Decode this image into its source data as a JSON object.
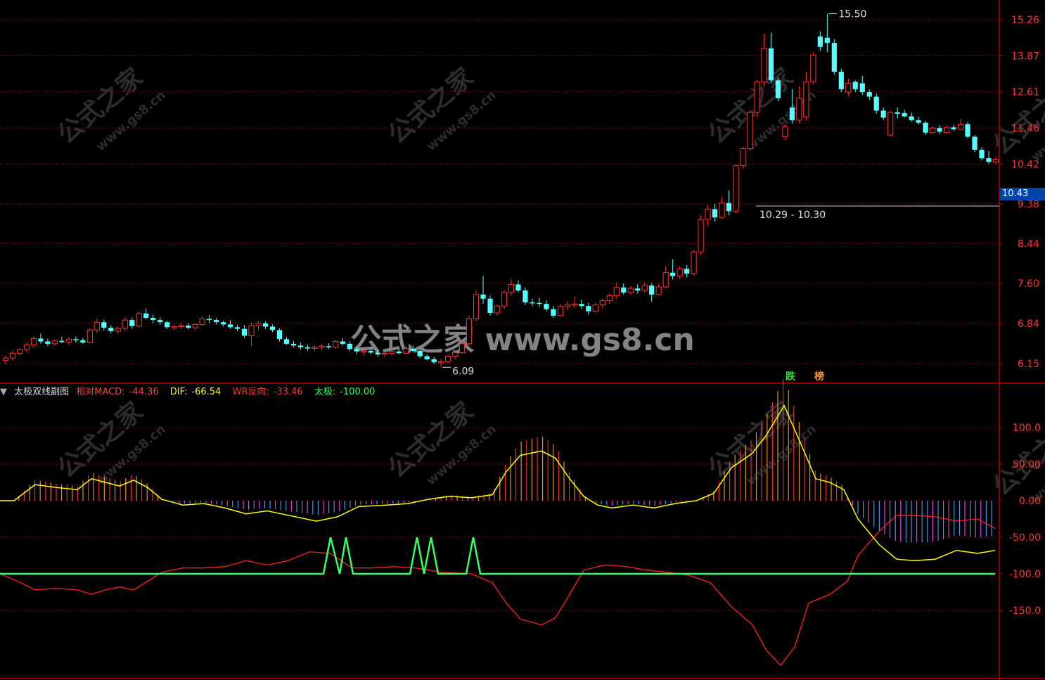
{
  "colors": {
    "background": "#000000",
    "up": "#ff3232",
    "down": "#54ffff",
    "grid": "#8b0000",
    "axis_text": "#ff3232",
    "dif_line": "#ffff00",
    "wr_line": "#ff2020",
    "taiji_line": "#33ff66",
    "hist_up": "#ffa020",
    "hist_down": "#4aa8ff",
    "hist_magenta": "#ff40ff"
  },
  "chart_data": [
    {
      "type": "candlestick",
      "name": "main",
      "y_ticks": [
        "15.26",
        "13.87",
        "12.61",
        "11.46",
        "10.42",
        "9.38",
        "8.44",
        "7.60",
        "6.84",
        "6.15"
      ],
      "ylim": [
        6.0,
        15.5
      ],
      "log_scale": true,
      "grid": true,
      "annotations": {
        "high_label": "15.50",
        "low_label": "6.09",
        "range_label": "10.29 - 10.30",
        "current_price": "10.43",
        "badges": [
          "跌",
          "榜"
        ]
      },
      "ohlc": [
        [
          6.2,
          6.28,
          6.14,
          6.24
        ],
        [
          6.24,
          6.36,
          6.2,
          6.32
        ],
        [
          6.32,
          6.41,
          6.28,
          6.38
        ],
        [
          6.38,
          6.5,
          6.33,
          6.46
        ],
        [
          6.46,
          6.61,
          6.42,
          6.57
        ],
        [
          6.57,
          6.66,
          6.48,
          6.52
        ],
        [
          6.52,
          6.57,
          6.44,
          6.48
        ],
        [
          6.48,
          6.55,
          6.45,
          6.53
        ],
        [
          6.53,
          6.6,
          6.49,
          6.51
        ],
        [
          6.51,
          6.6,
          6.46,
          6.56
        ],
        [
          6.56,
          6.61,
          6.5,
          6.54
        ],
        [
          6.54,
          6.58,
          6.48,
          6.5
        ],
        [
          6.5,
          6.76,
          6.48,
          6.72
        ],
        [
          6.72,
          6.93,
          6.66,
          6.86
        ],
        [
          6.86,
          6.91,
          6.71,
          6.76
        ],
        [
          6.76,
          6.81,
          6.66,
          6.7
        ],
        [
          6.7,
          6.78,
          6.65,
          6.75
        ],
        [
          6.75,
          6.95,
          6.7,
          6.9
        ],
        [
          6.9,
          6.94,
          6.74,
          6.79
        ],
        [
          6.79,
          7.06,
          6.76,
          7.02
        ],
        [
          7.02,
          7.11,
          6.91,
          6.94
        ],
        [
          6.94,
          7.0,
          6.84,
          6.9
        ],
        [
          6.9,
          6.95,
          6.81,
          6.86
        ],
        [
          6.86,
          6.89,
          6.74,
          6.77
        ],
        [
          6.77,
          6.82,
          6.72,
          6.78
        ],
        [
          6.78,
          6.85,
          6.74,
          6.8
        ],
        [
          6.8,
          6.84,
          6.73,
          6.76
        ],
        [
          6.76,
          6.84,
          6.72,
          6.82
        ],
        [
          6.82,
          6.96,
          6.8,
          6.92
        ],
        [
          6.92,
          6.99,
          6.84,
          6.9
        ],
        [
          6.9,
          6.94,
          6.82,
          6.86
        ],
        [
          6.86,
          6.89,
          6.78,
          6.82
        ],
        [
          6.82,
          6.9,
          6.74,
          6.77
        ],
        [
          6.77,
          6.82,
          6.7,
          6.74
        ],
        [
          6.74,
          6.81,
          6.58,
          6.62
        ],
        [
          6.62,
          6.85,
          6.44,
          6.8
        ],
        [
          6.8,
          6.88,
          6.72,
          6.84
        ],
        [
          6.84,
          6.88,
          6.74,
          6.78
        ],
        [
          6.78,
          6.82,
          6.68,
          6.72
        ],
        [
          6.72,
          6.75,
          6.52,
          6.56
        ],
        [
          6.56,
          6.6,
          6.46,
          6.48
        ],
        [
          6.48,
          6.53,
          6.42,
          6.45
        ],
        [
          6.45,
          6.5,
          6.38,
          6.42
        ],
        [
          6.42,
          6.47,
          6.36,
          6.4
        ],
        [
          6.4,
          6.45,
          6.35,
          6.42
        ],
        [
          6.42,
          6.48,
          6.37,
          6.44
        ],
        [
          6.44,
          6.49,
          6.39,
          6.42
        ],
        [
          6.42,
          6.55,
          6.4,
          6.52
        ],
        [
          6.52,
          6.58,
          6.45,
          6.48
        ],
        [
          6.48,
          6.52,
          6.36,
          6.39
        ],
        [
          6.39,
          6.44,
          6.3,
          6.35
        ],
        [
          6.35,
          6.41,
          6.28,
          6.36
        ],
        [
          6.36,
          6.42,
          6.3,
          6.33
        ],
        [
          6.33,
          6.39,
          6.26,
          6.3
        ],
        [
          6.3,
          6.36,
          6.25,
          6.32
        ],
        [
          6.32,
          6.38,
          6.28,
          6.35
        ],
        [
          6.35,
          6.41,
          6.3,
          6.32
        ],
        [
          6.32,
          6.44,
          6.3,
          6.4
        ],
        [
          6.4,
          6.45,
          6.33,
          6.36
        ],
        [
          6.36,
          6.4,
          6.24,
          6.27
        ],
        [
          6.27,
          6.3,
          6.2,
          6.22
        ],
        [
          6.22,
          6.26,
          6.14,
          6.17
        ],
        [
          6.17,
          6.23,
          6.09,
          6.18
        ],
        [
          6.18,
          6.3,
          6.15,
          6.27
        ],
        [
          6.27,
          6.36,
          6.22,
          6.33
        ],
        [
          6.33,
          6.51,
          6.3,
          6.48
        ],
        [
          6.48,
          6.98,
          6.45,
          6.92
        ],
        [
          6.92,
          7.47,
          6.88,
          7.38
        ],
        [
          7.38,
          7.76,
          7.2,
          7.3
        ],
        [
          7.3,
          7.36,
          6.98,
          7.03
        ],
        [
          7.03,
          7.19,
          6.98,
          7.16
        ],
        [
          7.16,
          7.47,
          7.1,
          7.42
        ],
        [
          7.42,
          7.69,
          7.36,
          7.58
        ],
        [
          7.58,
          7.66,
          7.42,
          7.46
        ],
        [
          7.46,
          7.52,
          7.18,
          7.23
        ],
        [
          7.23,
          7.3,
          7.16,
          7.22
        ],
        [
          7.22,
          7.32,
          7.14,
          7.2
        ],
        [
          7.2,
          7.27,
          7.06,
          7.1
        ],
        [
          7.1,
          7.16,
          6.94,
          6.98
        ],
        [
          6.98,
          7.2,
          6.96,
          7.15
        ],
        [
          7.15,
          7.25,
          7.08,
          7.18
        ],
        [
          7.18,
          7.35,
          7.12,
          7.2
        ],
        [
          7.2,
          7.28,
          7.1,
          7.16
        ],
        [
          7.16,
          7.22,
          7.0,
          7.06
        ],
        [
          7.06,
          7.22,
          7.04,
          7.18
        ],
        [
          7.18,
          7.3,
          7.12,
          7.26
        ],
        [
          7.26,
          7.4,
          7.2,
          7.36
        ],
        [
          7.36,
          7.62,
          7.3,
          7.52
        ],
        [
          7.52,
          7.6,
          7.38,
          7.42
        ],
        [
          7.42,
          7.55,
          7.38,
          7.5
        ],
        [
          7.5,
          7.58,
          7.4,
          7.46
        ],
        [
          7.46,
          7.62,
          7.42,
          7.56
        ],
        [
          7.56,
          7.6,
          7.24,
          7.38
        ],
        [
          7.38,
          7.58,
          7.36,
          7.53
        ],
        [
          7.53,
          7.95,
          7.5,
          7.82
        ],
        [
          7.82,
          8.1,
          7.68,
          7.75
        ],
        [
          7.75,
          7.95,
          7.7,
          7.9
        ],
        [
          7.9,
          7.98,
          7.72,
          7.8
        ],
        [
          7.8,
          8.3,
          7.76,
          8.26
        ],
        [
          8.26,
          9.1,
          8.2,
          9.0
        ],
        [
          9.0,
          9.35,
          8.85,
          9.25
        ],
        [
          9.25,
          9.38,
          8.95,
          9.05
        ],
        [
          9.05,
          9.55,
          9.0,
          9.4
        ],
        [
          9.4,
          9.72,
          9.1,
          9.2
        ],
        [
          9.2,
          10.4,
          9.15,
          10.38
        ],
        [
          10.38,
          10.9,
          10.3,
          10.85
        ],
        [
          10.85,
          12.0,
          10.8,
          11.95
        ],
        [
          11.95,
          13.0,
          11.8,
          12.95
        ],
        [
          12.95,
          14.7,
          12.8,
          14.15
        ],
        [
          14.15,
          14.75,
          12.9,
          13.0
        ],
        [
          13.0,
          13.1,
          12.3,
          12.4
        ],
        [
          11.2,
          11.55,
          11.1,
          11.5
        ],
        [
          12.1,
          12.7,
          11.6,
          11.7
        ],
        [
          11.7,
          12.8,
          11.6,
          12.4
        ],
        [
          11.8,
          13.3,
          11.7,
          12.95
        ],
        [
          12.95,
          14.0,
          12.85,
          13.9
        ],
        [
          14.6,
          14.8,
          14.05,
          14.2
        ],
        [
          14.55,
          15.5,
          14.0,
          14.35
        ],
        [
          14.35,
          14.5,
          13.2,
          13.3
        ],
        [
          13.3,
          13.4,
          12.6,
          12.7
        ],
        [
          12.6,
          13.05,
          12.45,
          12.9
        ],
        [
          12.95,
          13.0,
          12.6,
          12.7
        ],
        [
          12.9,
          13.15,
          12.5,
          12.6
        ],
        [
          12.6,
          12.7,
          12.35,
          12.45
        ],
        [
          12.45,
          12.55,
          11.9,
          12.0
        ],
        [
          12.0,
          12.1,
          11.7,
          11.78
        ],
        [
          11.25,
          12.0,
          11.2,
          11.95
        ],
        [
          11.95,
          12.1,
          11.75,
          11.9
        ],
        [
          11.92,
          12.02,
          11.78,
          11.82
        ],
        [
          11.82,
          11.95,
          11.65,
          11.7
        ],
        [
          11.7,
          11.8,
          11.56,
          11.62
        ],
        [
          11.62,
          11.68,
          11.25,
          11.32
        ],
        [
          11.32,
          11.5,
          11.3,
          11.46
        ],
        [
          11.46,
          11.55,
          11.28,
          11.35
        ],
        [
          11.32,
          11.54,
          11.28,
          11.48
        ],
        [
          11.48,
          11.56,
          11.38,
          11.42
        ],
        [
          11.42,
          11.74,
          11.4,
          11.58
        ],
        [
          11.58,
          11.65,
          11.15,
          11.2
        ],
        [
          11.2,
          11.25,
          10.75,
          10.82
        ],
        [
          10.82,
          10.9,
          10.52,
          10.58
        ],
        [
          10.58,
          10.78,
          10.42,
          10.48
        ],
        [
          10.48,
          10.62,
          10.43,
          10.55
        ]
      ]
    },
    {
      "type": "line+histogram",
      "name": "taiji_indicator",
      "title": "太极双线副图",
      "y_ticks": [
        "100.0",
        "50.00",
        "0.00",
        "-50.00",
        "-100.0",
        "-150.0"
      ],
      "ylim": [
        -230,
        140
      ],
      "legend": [
        {
          "label": "相对MACD:",
          "value": "-44.36"
        },
        {
          "label": "DIF:",
          "value": "-66.54"
        },
        {
          "label": "WR反向:",
          "value": "-33.46"
        },
        {
          "label": "太极:",
          "value": "-100.00"
        }
      ],
      "dif": [
        [
          0,
          0
        ],
        [
          20,
          0
        ],
        [
          50,
          22
        ],
        [
          80,
          18
        ],
        [
          110,
          15
        ],
        [
          130,
          30
        ],
        [
          150,
          25
        ],
        [
          170,
          20
        ],
        [
          190,
          28
        ],
        [
          210,
          18
        ],
        [
          230,
          2
        ],
        [
          260,
          -6
        ],
        [
          290,
          -4
        ],
        [
          320,
          -10
        ],
        [
          350,
          -18
        ],
        [
          380,
          -14
        ],
        [
          410,
          -20
        ],
        [
          450,
          -28
        ],
        [
          480,
          -22
        ],
        [
          510,
          -8
        ],
        [
          550,
          -6
        ],
        [
          580,
          -4
        ],
        [
          610,
          2
        ],
        [
          640,
          6
        ],
        [
          670,
          4
        ],
        [
          700,
          8
        ],
        [
          720,
          40
        ],
        [
          740,
          62
        ],
        [
          770,
          68
        ],
        [
          790,
          58
        ],
        [
          810,
          30
        ],
        [
          830,
          6
        ],
        [
          850,
          -6
        ],
        [
          870,
          -10
        ],
        [
          900,
          -6
        ],
        [
          930,
          -10
        ],
        [
          960,
          -4
        ],
        [
          990,
          0
        ],
        [
          1015,
          10
        ],
        [
          1040,
          45
        ],
        [
          1070,
          65
        ],
        [
          1090,
          90
        ],
        [
          1115,
          130
        ],
        [
          1140,
          75
        ],
        [
          1160,
          30
        ],
        [
          1180,
          25
        ],
        [
          1200,
          15
        ],
        [
          1220,
          -25
        ],
        [
          1250,
          -60
        ],
        [
          1275,
          -80
        ],
        [
          1300,
          -82
        ],
        [
          1330,
          -80
        ],
        [
          1360,
          -68
        ],
        [
          1390,
          -72
        ],
        [
          1415,
          -68
        ]
      ],
      "wr": [
        [
          0,
          -100
        ],
        [
          20,
          -108
        ],
        [
          50,
          -122
        ],
        [
          80,
          -120
        ],
        [
          110,
          -122
        ],
        [
          130,
          -128
        ],
        [
          150,
          -122
        ],
        [
          170,
          -118
        ],
        [
          190,
          -122
        ],
        [
          210,
          -110
        ],
        [
          230,
          -98
        ],
        [
          260,
          -92
        ],
        [
          290,
          -92
        ],
        [
          320,
          -90
        ],
        [
          350,
          -82
        ],
        [
          380,
          -88
        ],
        [
          410,
          -82
        ],
        [
          440,
          -70
        ],
        [
          470,
          -72
        ],
        [
          500,
          -92
        ],
        [
          530,
          -92
        ],
        [
          560,
          -90
        ],
        [
          590,
          -92
        ],
        [
          630,
          -98
        ],
        [
          670,
          -100
        ],
        [
          700,
          -112
        ],
        [
          720,
          -140
        ],
        [
          740,
          -162
        ],
        [
          770,
          -170
        ],
        [
          790,
          -160
        ],
        [
          810,
          -128
        ],
        [
          830,
          -95
        ],
        [
          860,
          -88
        ],
        [
          890,
          -90
        ],
        [
          920,
          -95
        ],
        [
          950,
          -98
        ],
        [
          980,
          -102
        ],
        [
          1010,
          -112
        ],
        [
          1040,
          -145
        ],
        [
          1070,
          -170
        ],
        [
          1090,
          -205
        ],
        [
          1110,
          -225
        ],
        [
          1130,
          -200
        ],
        [
          1150,
          -140
        ],
        [
          1180,
          -128
        ],
        [
          1205,
          -110
        ],
        [
          1220,
          -75
        ],
        [
          1250,
          -42
        ],
        [
          1275,
          -20
        ],
        [
          1300,
          -20
        ],
        [
          1330,
          -22
        ],
        [
          1360,
          -28
        ],
        [
          1390,
          -25
        ],
        [
          1415,
          -38
        ]
      ],
      "taiji": [
        [
          0,
          -100
        ],
        [
          460,
          -100
        ],
        [
          470,
          -50
        ],
        [
          483,
          -100
        ],
        [
          492,
          -50
        ],
        [
          502,
          -100
        ],
        [
          583,
          -100
        ],
        [
          593,
          -50
        ],
        [
          603,
          -100
        ],
        [
          613,
          -50
        ],
        [
          623,
          -100
        ],
        [
          663,
          -100
        ],
        [
          673,
          -50
        ],
        [
          683,
          -100
        ],
        [
          1415,
          -100
        ]
      ]
    }
  ],
  "text": {
    "watermark_main": "公式之家 www.gs8.cn",
    "watermark_tile": "公式之家",
    "watermark_tile_url": "www.gs8.cn"
  }
}
